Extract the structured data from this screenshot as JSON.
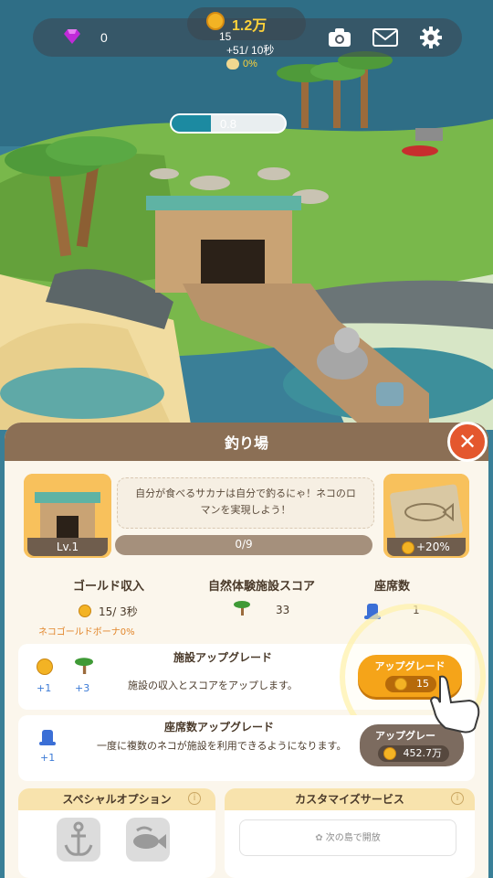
{
  "hud": {
    "gems": "0",
    "gold": "1.2万",
    "timer": "15",
    "rate": "+51/ 10秒",
    "bonus": "0%",
    "progress_label": "0.8",
    "progress_fraction": 0.35
  },
  "panel": {
    "title": "釣り場",
    "level": "Lv.1",
    "description": "自分が食べるサカナは自分で釣るにゃ！ネコのロマンを実現しよう！",
    "progress_text": "0/9",
    "progress_fraction": 0.0,
    "reward": "+20%"
  },
  "stats": {
    "gold_income_label": "ゴールド収入",
    "gold_income_value": "15/ 3秒",
    "gold_bonus": "ネコゴールドボーナ0%",
    "score_label": "自然体験施設スコア",
    "score_value": "33",
    "seats_label": "座席数",
    "seats_value": "1"
  },
  "upgrade_facility": {
    "title": "施設アップグレード",
    "desc": "施設の収入とスコアをアップします。",
    "plus_gold": "+1",
    "plus_score": "+3",
    "button": "アップグレード",
    "price": "15"
  },
  "upgrade_seats": {
    "title": "座席数アップグレード",
    "desc": "一度に複数のネコが施設を利用できるようになります。",
    "plus_seat": "+1",
    "button": "アップグレー",
    "price": "452.7万"
  },
  "special": {
    "title": "スペシャルオプション"
  },
  "custom": {
    "title": "カスタマイズサービス",
    "locked": "次の島で開放"
  },
  "colors": {
    "panel_header": "#8b6f55",
    "button_orange": "#f5a419",
    "close_red": "#e4572e",
    "gold": "#f3b324"
  }
}
